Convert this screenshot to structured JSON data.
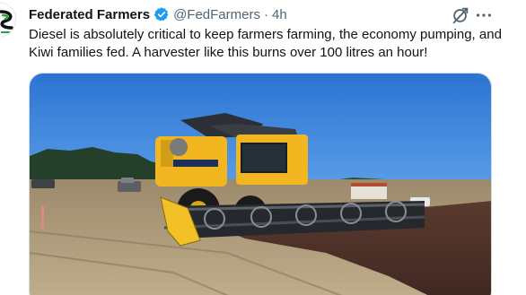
{
  "author": {
    "display_name": "Federated Farmers",
    "handle": "@FedFarmers",
    "separator": "·",
    "time": "4h",
    "avatar_icon": "federated-farmers-logo",
    "verified_icon": "verified-badge-icon",
    "verified_color": "#1d9bf0"
  },
  "tweet": {
    "text": "Diesel is absolutely critical to keep farmers farming, the economy pumping, and Kiwi families fed. A harvester like this burns over 100 litres an hour!"
  },
  "actions": {
    "grok_icon": "grok-icon",
    "more_icon": "more-dots-icon"
  },
  "media": {
    "type": "video-still",
    "subject": "harvester-photo"
  },
  "colors": {
    "text": "#0f1419",
    "secondary": "#536471",
    "harvester_yellow": "#f2b620",
    "sky": "#2f7fd8"
  }
}
